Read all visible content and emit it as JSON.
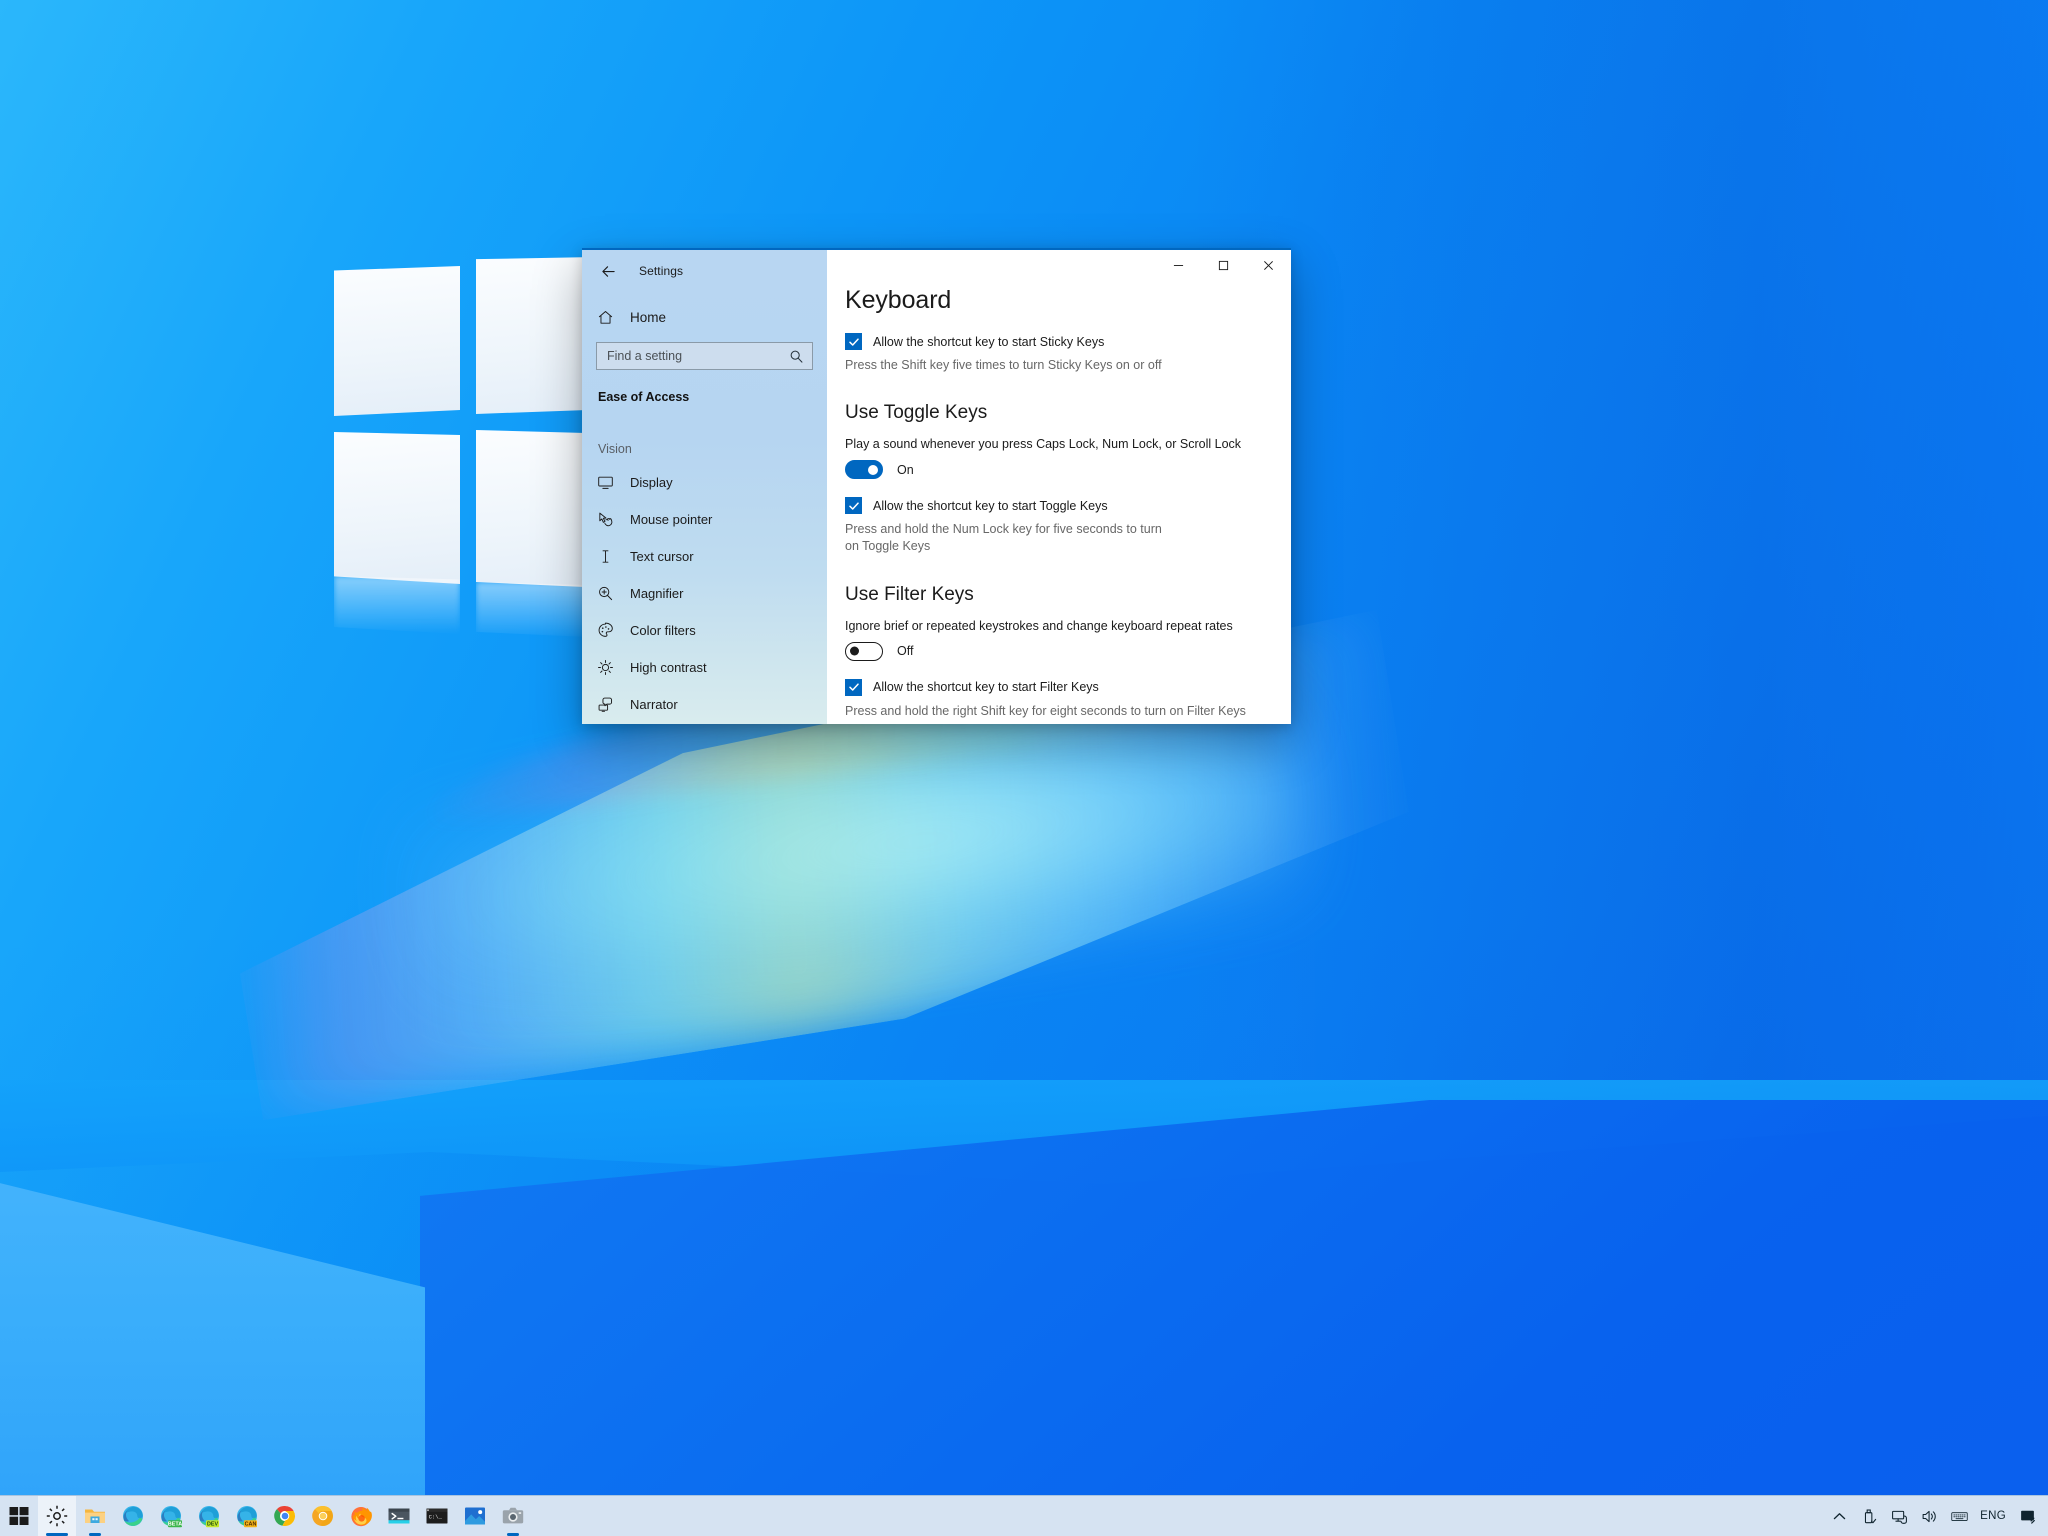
{
  "desktop": {
    "wallpaper_name": "windows-logo-blue-wallpaper",
    "colors": {
      "sky": "#0a86f4",
      "accent": "#0067c0",
      "taskbar": "#d6e3f2"
    }
  },
  "window": {
    "app_title": "Settings",
    "back_icon": "back-arrow-icon",
    "controls": {
      "minimize": "minimize-icon",
      "maximize": "maximize-icon",
      "close": "close-icon"
    }
  },
  "sidebar": {
    "home": {
      "label": "Home",
      "icon": "home-icon"
    },
    "search": {
      "placeholder": "Find a setting",
      "value": "",
      "icon": "search-icon"
    },
    "category": "Ease of Access",
    "group_label": "Vision",
    "items": [
      {
        "label": "Display",
        "icon": "display-icon"
      },
      {
        "label": "Mouse pointer",
        "icon": "mouse-pointer-icon"
      },
      {
        "label": "Text cursor",
        "icon": "text-cursor-icon"
      },
      {
        "label": "Magnifier",
        "icon": "magnifier-icon"
      },
      {
        "label": "Color filters",
        "icon": "color-filters-icon"
      },
      {
        "label": "High contrast",
        "icon": "high-contrast-icon"
      },
      {
        "label": "Narrator",
        "icon": "narrator-icon"
      }
    ]
  },
  "main": {
    "page_title": "Keyboard",
    "sticky_keys": {
      "checkbox_label": "Allow the shortcut key to start Sticky Keys",
      "checked": true,
      "helper": "Press the Shift key five times to turn Sticky Keys on or off"
    },
    "toggle_keys": {
      "heading": "Use Toggle Keys",
      "description": "Play a sound whenever you press Caps Lock, Num Lock, or Scroll Lock",
      "switch_state": "On",
      "switch_on": true,
      "checkbox_label": "Allow the shortcut key to start Toggle Keys",
      "checked": true,
      "helper": "Press and hold the Num Lock key for five seconds to turn on Toggle Keys"
    },
    "filter_keys": {
      "heading": "Use Filter Keys",
      "description": "Ignore brief or repeated keystrokes and change keyboard repeat rates",
      "switch_state": "Off",
      "switch_on": false,
      "checkbox_label": "Allow the shortcut key to start Filter Keys",
      "checked": true,
      "helper": "Press and hold the right Shift key for eight seconds to turn on Filter Keys"
    }
  },
  "taskbar": {
    "items": [
      {
        "name": "start-button",
        "icon": "windows-logo-icon",
        "active": false,
        "underline": false
      },
      {
        "name": "settings-taskbar-button",
        "icon": "gear-icon",
        "active": true,
        "underline": true
      },
      {
        "name": "file-explorer-taskbar-button",
        "icon": "folder-icon",
        "active": false,
        "underline": true
      },
      {
        "name": "edge-taskbar-button",
        "icon": "edge-icon",
        "active": false,
        "underline": false
      },
      {
        "name": "edge-beta-taskbar-button",
        "icon": "edge-beta-icon",
        "badge": "BETA",
        "active": false,
        "underline": false
      },
      {
        "name": "edge-dev-taskbar-button",
        "icon": "edge-dev-icon",
        "badge": "DEV",
        "active": false,
        "underline": false
      },
      {
        "name": "edge-canary-taskbar-button",
        "icon": "edge-canary-icon",
        "badge": "CAN",
        "active": false,
        "underline": false
      },
      {
        "name": "chrome-taskbar-button",
        "icon": "chrome-icon",
        "active": false,
        "underline": false
      },
      {
        "name": "chrome-canary-taskbar-button",
        "icon": "chrome-canary-icon",
        "active": false,
        "underline": false
      },
      {
        "name": "firefox-taskbar-button",
        "icon": "firefox-icon",
        "active": false,
        "underline": false
      },
      {
        "name": "terminal-taskbar-button",
        "icon": "windows-terminal-icon",
        "active": false,
        "underline": false
      },
      {
        "name": "command-prompt-taskbar-button",
        "icon": "command-prompt-icon",
        "active": false,
        "underline": false
      },
      {
        "name": "photos-taskbar-button",
        "icon": "photos-icon",
        "active": false,
        "underline": false
      },
      {
        "name": "snipping-tool-taskbar-button",
        "icon": "camera-icon",
        "active": false,
        "underline": true
      }
    ],
    "tray": [
      {
        "name": "show-hidden-icons",
        "icon": "chevron-up-icon",
        "label": ""
      },
      {
        "name": "safely-remove-hardware",
        "icon": "usb-icon",
        "label": ""
      },
      {
        "name": "network-icon",
        "icon": "network-icon",
        "label": ""
      },
      {
        "name": "volume-icon",
        "icon": "speaker-icon",
        "label": ""
      },
      {
        "name": "touch-keyboard",
        "icon": "keyboard-icon",
        "label": ""
      },
      {
        "name": "language-indicator",
        "icon": "",
        "label": "ENG"
      },
      {
        "name": "action-center",
        "icon": "action-center-icon",
        "label": ""
      }
    ]
  }
}
